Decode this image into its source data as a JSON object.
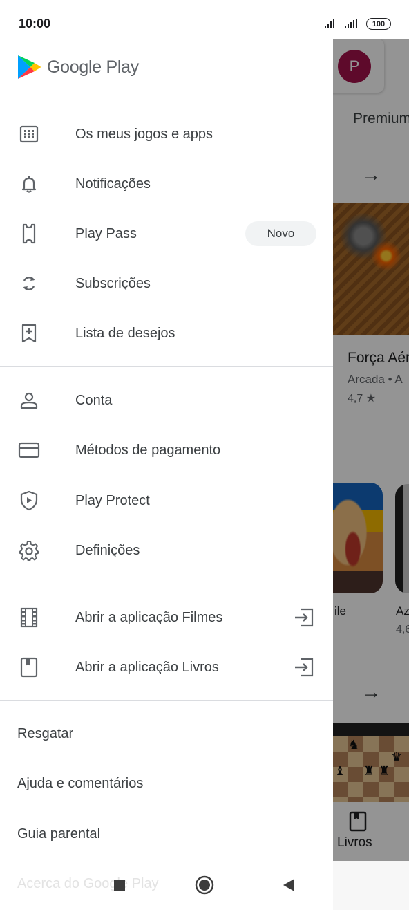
{
  "status_bar": {
    "time": "10:00",
    "battery": "100"
  },
  "drawer": {
    "logo_text": "Google Play",
    "section1": [
      {
        "icon": "grid-icon",
        "label": "Os meus jogos e apps"
      },
      {
        "icon": "bell-icon",
        "label": "Notificações"
      },
      {
        "icon": "ticket-icon",
        "label": "Play Pass",
        "badge": "Novo"
      },
      {
        "icon": "refresh-icon",
        "label": "Subscrições"
      },
      {
        "icon": "bookmark-add-icon",
        "label": "Lista de desejos"
      }
    ],
    "section2": [
      {
        "icon": "person-icon",
        "label": "Conta"
      },
      {
        "icon": "credit-card-icon",
        "label": "Métodos de pagamento"
      },
      {
        "icon": "shield-play-icon",
        "label": "Play Protect"
      },
      {
        "icon": "gear-icon",
        "label": "Definições"
      }
    ],
    "section3": [
      {
        "icon": "film-icon",
        "label": "Abrir a aplicação Filmes",
        "trailing_icon": "open-external-icon"
      },
      {
        "icon": "book-icon",
        "label": "Abrir a aplicação Livros",
        "trailing_icon": "open-external-icon"
      }
    ],
    "section4": [
      "Resgatar",
      "Ajuda e comentários",
      "Guia parental",
      "Acerca do Google Play"
    ]
  },
  "background": {
    "avatar_letter": "P",
    "tab_label": "Premium",
    "game_title": "Força Aérea",
    "game_category": "Arcada • A",
    "game_rating": "4,7 ★",
    "app_label_1": "ile",
    "app_label_2": "Az",
    "app_rating_2": "4,6",
    "bottom_tab_label": "Livros"
  },
  "colors": {
    "accent_avatar": "#a3124a",
    "text_primary": "#3c4043",
    "divider": "#dadce0",
    "chip_bg": "#f1f3f4"
  }
}
